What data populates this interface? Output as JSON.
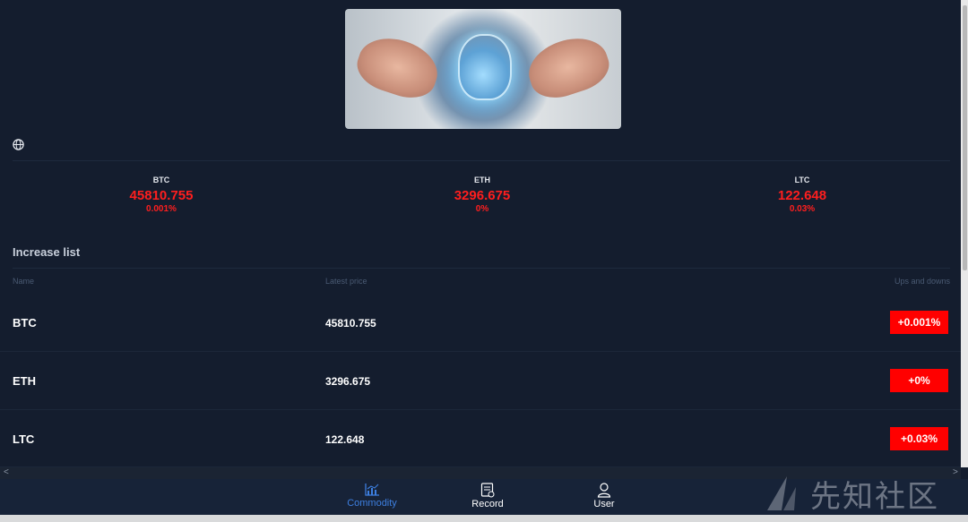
{
  "banner": {
    "image": "ai-brain-hands-illustration"
  },
  "icons": {
    "globe": "globe-icon"
  },
  "tickers": [
    {
      "symbol": "BTC",
      "price": "45810.755",
      "change": "0.001%"
    },
    {
      "symbol": "ETH",
      "price": "3296.675",
      "change": "0%"
    },
    {
      "symbol": "LTC",
      "price": "122.648",
      "change": "0.03%"
    }
  ],
  "increase_list": {
    "title": "Increase list",
    "columns": {
      "name": "Name",
      "price": "Latest price",
      "change": "Ups and downs"
    },
    "rows": [
      {
        "name": "BTC",
        "price": "45810.755",
        "change": "+0.001%"
      },
      {
        "name": "ETH",
        "price": "3296.675",
        "change": "+0%"
      },
      {
        "name": "LTC",
        "price": "122.648",
        "change": "+0.03%"
      }
    ]
  },
  "scrollbar": {
    "left_arrow": "<",
    "right_arrow": ">"
  },
  "tabbar": {
    "tabs": [
      {
        "label": "Commodity",
        "icon": "chart-icon",
        "active": true
      },
      {
        "label": "Record",
        "icon": "document-icon",
        "active": false
      },
      {
        "label": "User",
        "icon": "user-icon",
        "active": false
      }
    ]
  },
  "watermark": {
    "text": "先知社区"
  },
  "colors": {
    "background": "#141d2e",
    "down": "#ff1e1e",
    "badge": "#ff0000",
    "active_tab": "#3d7fe0",
    "tabbar": "#172338"
  }
}
